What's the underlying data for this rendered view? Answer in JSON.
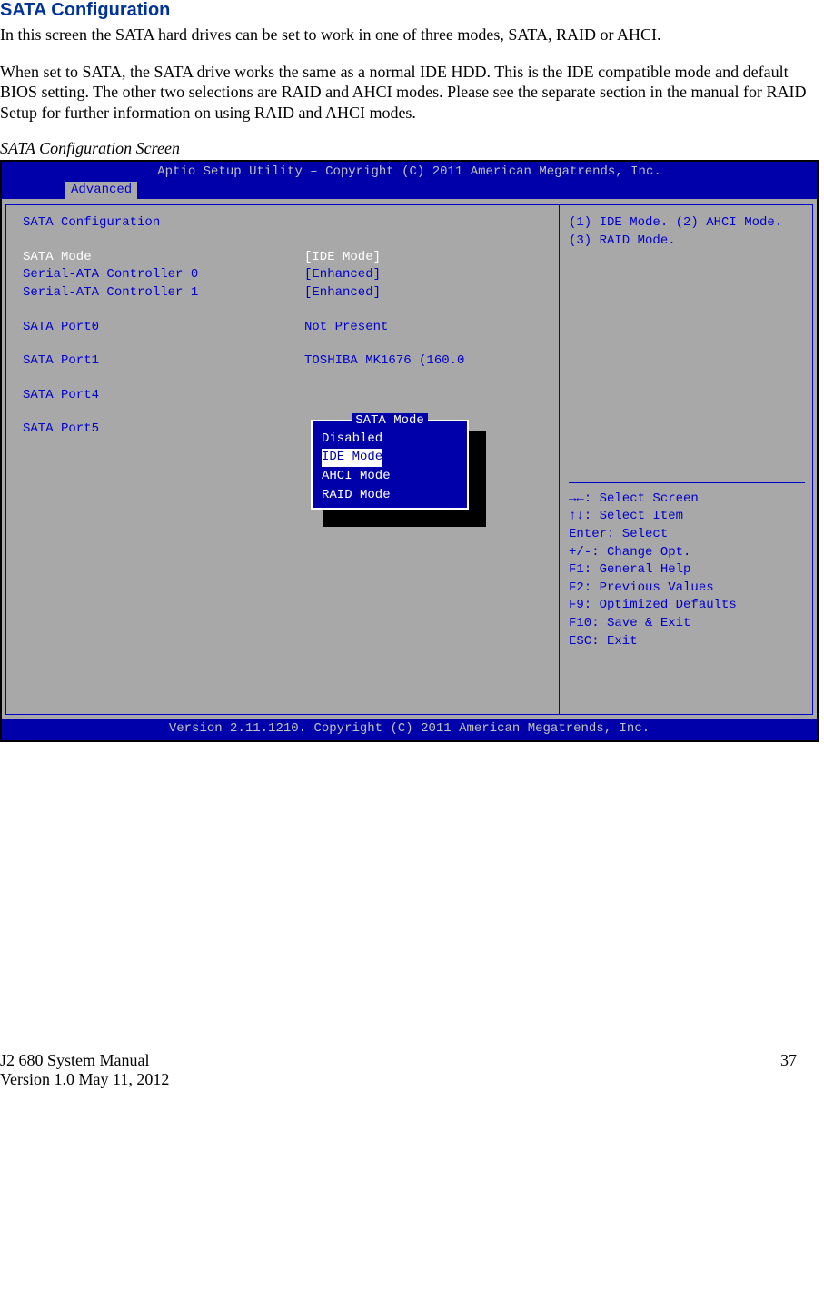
{
  "heading": "SATA Configuration",
  "para1": "In this screen the SATA hard drives can be set to work in one of three modes, SATA, RAID or AHCI.",
  "para2": "When set to SATA, the SATA drive works the same as a normal IDE HDD. This is the IDE compatible mode and default BIOS setting. The other two selections are RAID and AHCI modes. Please see the separate section in the manual for RAID Setup for further information on using RAID and AHCI modes.",
  "caption": "SATA Configuration Screen",
  "bios": {
    "header": "Aptio Setup Utility – Copyright (C) 2011 American Megatrends, Inc.",
    "tab": "Advanced",
    "title": "SATA Configuration",
    "rows": [
      {
        "label": "SATA Mode",
        "value": "[IDE Mode]",
        "labelColor": "white",
        "valueColor": "white"
      },
      {
        "label": "Serial-ATA Controller 0",
        "value": "[Enhanced]",
        "labelColor": "blue",
        "valueColor": "blue"
      },
      {
        "label": "Serial-ATA Controller 1",
        "value": "[Enhanced]",
        "labelColor": "blue",
        "valueColor": "blue"
      }
    ],
    "ports": [
      {
        "label": "SATA Port0",
        "value": "Not Present"
      },
      {
        "label": "SATA Port1",
        "value": "TOSHIBA MK1676 (160.0"
      },
      {
        "label": "SATA Port4",
        "value": ""
      },
      {
        "label": "SATA Port5",
        "value": ""
      }
    ],
    "popup": {
      "title": "SATA Mode",
      "options": [
        "Disabled",
        "IDE Mode",
        "AHCI Mode",
        "RAID Mode"
      ],
      "selected": "IDE Mode"
    },
    "help_top": "(1) IDE Mode. (2) AHCI Mode. (3) RAID Mode.",
    "help_keys": [
      "→←: Select Screen",
      "↑↓: Select Item",
      "Enter: Select",
      "+/-: Change Opt.",
      "F1: General Help",
      "F2: Previous Values",
      "F9: Optimized Defaults",
      "F10: Save & Exit",
      "ESC: Exit"
    ],
    "footer": "Version 2.11.1210. Copyright (C) 2011 American Megatrends, Inc."
  },
  "page_footer": {
    "left1": "J2 680 System Manual",
    "left2": "Version 1.0 May 11, 2012",
    "right": "37"
  }
}
